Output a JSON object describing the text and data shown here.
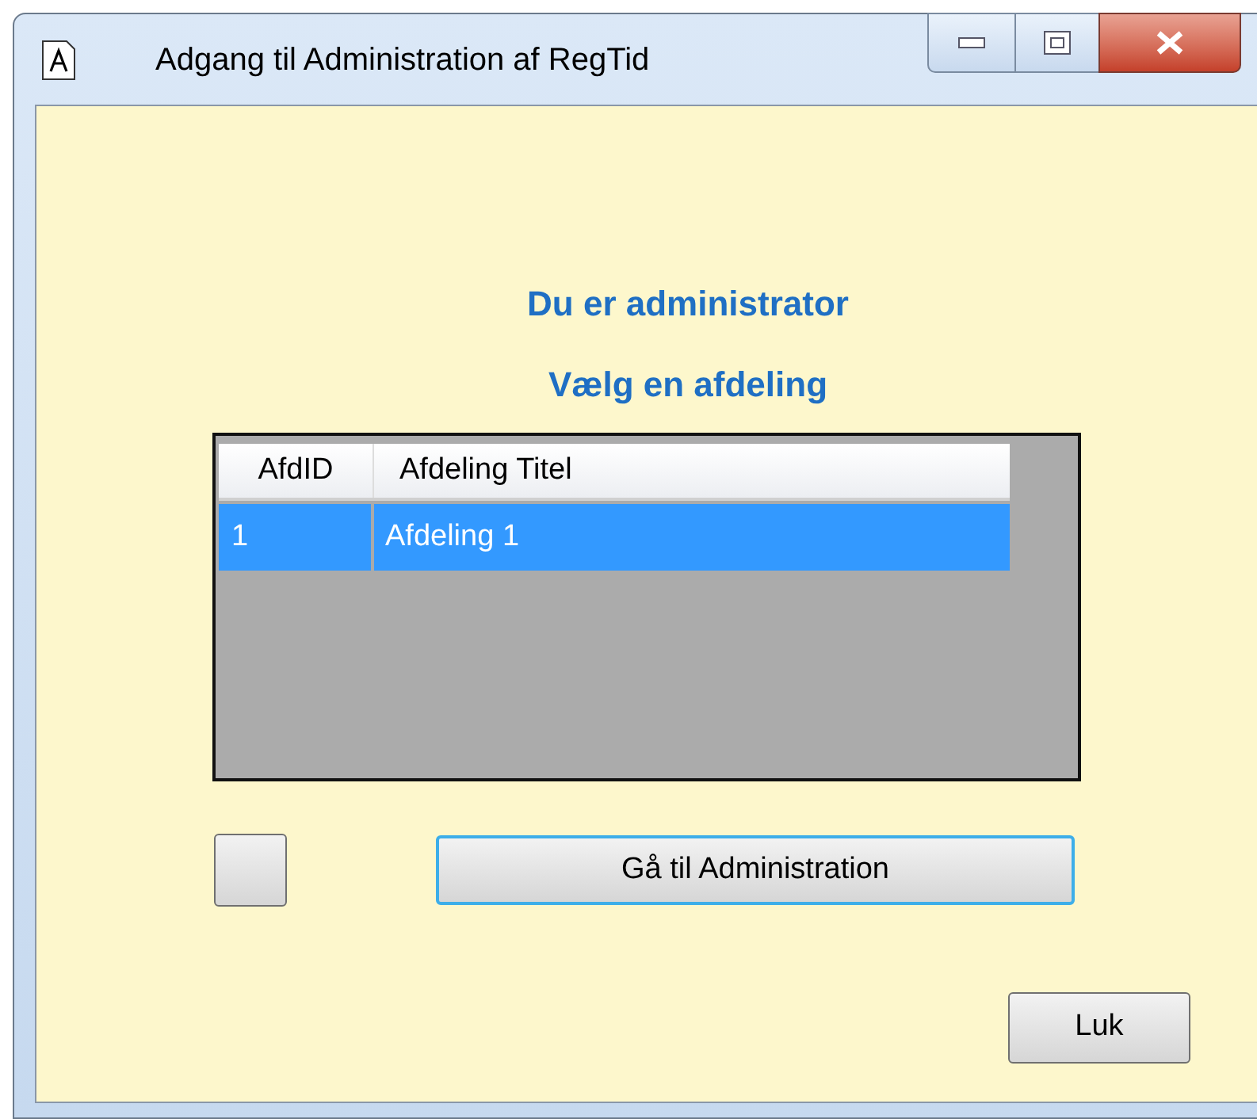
{
  "window": {
    "title": "Adgang til Administration af RegTid"
  },
  "headings": [
    "Du er administrator",
    "Vælg en afdeling"
  ],
  "table": {
    "columns": [
      "AfdID",
      "Afdeling Titel"
    ],
    "rows": [
      {
        "cells": [
          "1",
          "Afdeling 1"
        ],
        "selected": true
      }
    ]
  },
  "action_button": {
    "label": "Gå til Administration",
    "focused": true
  },
  "close_button": {
    "label": "Luk"
  }
}
